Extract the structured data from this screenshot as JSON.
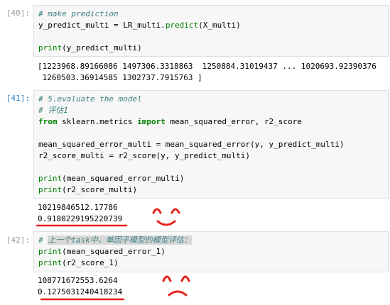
{
  "cells": [
    {
      "prompt": "[40]:",
      "input_lines": [
        [
          {
            "t": "# make prediction",
            "c": "cm"
          }
        ],
        [
          {
            "t": "y_predict_multi = LR_multi.",
            "c": ""
          },
          {
            "t": "predict",
            "c": "fn"
          },
          {
            "t": "(X_multi)",
            "c": ""
          }
        ],
        [],
        [
          {
            "t": "print",
            "c": "fn"
          },
          {
            "t": "(y_predict_multi)",
            "c": ""
          }
        ]
      ],
      "output_lines": [
        "[1223968.89166086 1497306.3318863  1250884.31019437 ... 1020693.92390376",
        " 1260503.36914585 1302737.7915763 ]"
      ]
    },
    {
      "prompt": "[41]:",
      "input_lines": [
        [
          {
            "t": "# 5.evaluate the model",
            "c": "cm"
          }
        ],
        [
          {
            "t": "# 评估1",
            "c": "cm"
          }
        ],
        [
          {
            "t": "from",
            "c": "kw"
          },
          {
            "t": " sklearn.metrics ",
            "c": ""
          },
          {
            "t": "import",
            "c": "kw"
          },
          {
            "t": " mean_squared_error, r2_score",
            "c": ""
          }
        ],
        [],
        [
          {
            "t": "mean_squared_error_multi = mean_squared_error(y, y_predict_multi)",
            "c": ""
          }
        ],
        [
          {
            "t": "r2_score_multi = r2_score(y, y_predict_multi)",
            "c": ""
          }
        ],
        [],
        [
          {
            "t": "print",
            "c": "fn"
          },
          {
            "t": "(mean_squared_error_multi)",
            "c": ""
          }
        ],
        [
          {
            "t": "print",
            "c": "fn"
          },
          {
            "t": "(r2_score_multi)",
            "c": ""
          }
        ]
      ],
      "output_lines": [
        "10219846512.17786",
        "0.9180229195220739"
      ]
    },
    {
      "prompt": "[42]:",
      "input_lines": [
        [
          {
            "t": "# ",
            "c": "cm"
          },
          {
            "t": "上一个task中，单因子模型的模型评估：",
            "c": "cm hl"
          }
        ],
        [
          {
            "t": "print",
            "c": "fn"
          },
          {
            "t": "(mean_squared_error_1)",
            "c": ""
          }
        ],
        [
          {
            "t": "print",
            "c": "fn"
          },
          {
            "t": "(r2_score_1)",
            "c": ""
          }
        ]
      ],
      "output_lines": [
        "108771672553.6264",
        "0.1275031240418234"
      ]
    }
  ],
  "colors": {
    "annotation_red": "#e8201c",
    "prompt_active": "#307fc1",
    "comment": "#408080",
    "keyword": "#008000"
  },
  "annotations": [
    "smiley-face-drawing",
    "frown-face-drawing"
  ]
}
